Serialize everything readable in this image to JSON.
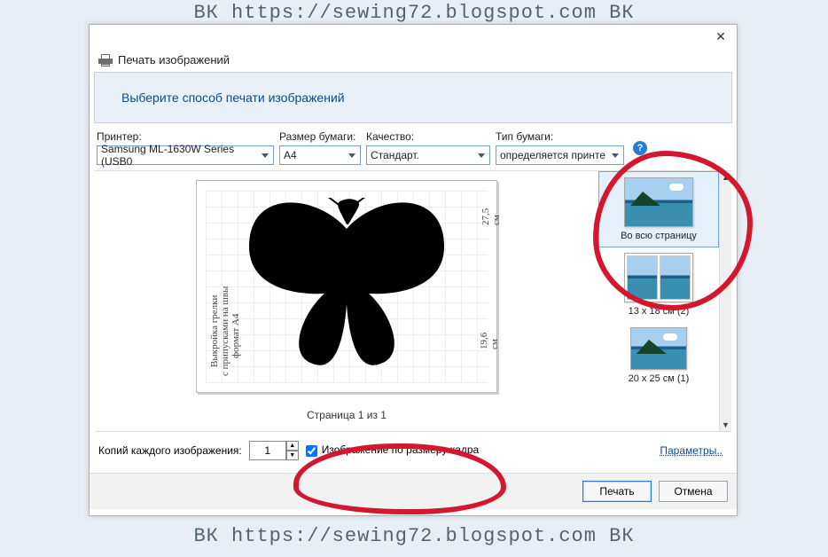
{
  "background_text": "ВК  https://sewing72.blogspot.com ВК",
  "dialog": {
    "title": "Печать изображений",
    "banner": "Выберите способ печати изображений",
    "options": {
      "printer_label": "Принтер:",
      "printer_value": "Samsung ML-1630W Series (USB0",
      "paper_size_label": "Размер бумаги:",
      "paper_size_value": "A4",
      "quality_label": "Качество:",
      "quality_value": "Стандарт.",
      "paper_type_label": "Тип бумаги:",
      "paper_type_value": "определяется принте"
    },
    "preview": {
      "side_text_1": "Выкройка грелки",
      "side_text_2": "с припусками на швы",
      "side_text_3": "формат A4",
      "top_text": "27,5 см",
      "right_text": "19,6 см",
      "page_caption": "Страница 1 из 1"
    },
    "layouts": [
      {
        "label": "Во всю страницу",
        "selected": true
      },
      {
        "label": "13 x 18 см (2)",
        "selected": false
      },
      {
        "label": "20 x 25 см (1)",
        "selected": false
      }
    ],
    "bottom": {
      "copies_label": "Копий каждого изображения:",
      "copies_value": "1",
      "fit_checkbox_label": "Изображение по размеру кадра",
      "fit_checked": true,
      "params_link": "Параметры.."
    },
    "buttons": {
      "print": "Печать",
      "cancel": "Отмена"
    }
  }
}
